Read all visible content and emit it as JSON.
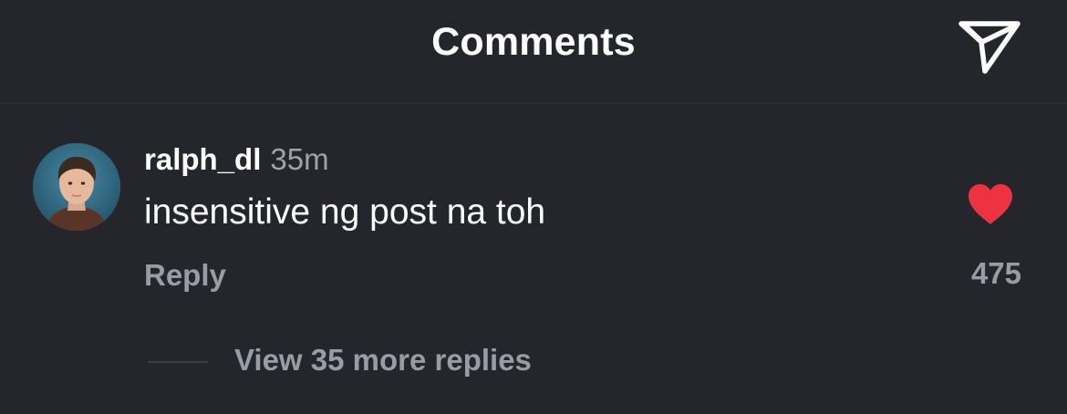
{
  "header": {
    "title": "Comments",
    "share_icon": "paper-plane-icon"
  },
  "comment": {
    "username": "ralph_dl",
    "timestamp": "35m",
    "text": "insensitive ng post na toh",
    "reply_label": "Reply",
    "like_icon": "heart-filled-icon",
    "like_color": "#ed3341",
    "like_count": "475",
    "view_replies_label": "View 35 more replies"
  },
  "colors": {
    "background": "#24262b",
    "primary_text": "#ffffff",
    "secondary_text": "#9a9ca3"
  }
}
